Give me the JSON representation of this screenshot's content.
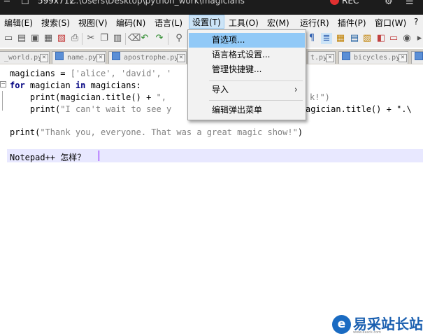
{
  "titlebar": {
    "title": "C:\\Users\\Desktop\\python_work\\magicians.py - Notepad++",
    "window_size": "599x712",
    "rec_label": "REC"
  },
  "menubar": {
    "items": [
      "编辑(E)",
      "搜索(S)",
      "视图(V)",
      "编码(N)",
      "语言(L)",
      "设置(T)",
      "工具(O)",
      "宏(M)",
      "运行(R)",
      "插件(P)",
      "窗口(W)",
      "?"
    ],
    "active": "设置(T)"
  },
  "tabs": [
    "_world.py",
    "name.py",
    "apostrophe.py",
    "t.py",
    "bicycles.py"
  ],
  "dropdown": {
    "items": [
      {
        "label": "首选项...",
        "selected": true
      },
      {
        "label": "语言格式设置..."
      },
      {
        "label": "管理快捷键..."
      },
      {
        "label": "导入",
        "submenu_arrow": "›"
      },
      {
        "label": "编辑弹出菜单"
      }
    ]
  },
  "editor": {
    "line1": {
      "code": "magicians = ",
      "str": "['alice', 'david', '"
    },
    "line2": {
      "kw": "for",
      "code": " magician ",
      "kw2": "in",
      "code2": " magicians:"
    },
    "line3": {
      "indent": "    ",
      "code": "print(magician.title() + ",
      "str": "\",",
      "str_tail": "k!\")"
    },
    "line4": {
      "indent": "    ",
      "code": "print(",
      "str": "\"I can't wait to see y",
      "tail": "agician.title() + \".\\"
    },
    "line5": {
      "code": "print(",
      "str": "\"Thank you, everyone. That was a great magic show!\"",
      "tail": ")"
    },
    "line6": {
      "code": "Notepad++ 怎样？"
    }
  },
  "watermark": {
    "logo_glyph": "e",
    "text": "易采站长站",
    "subtext": "www.easck.com"
  },
  "colors": {
    "menu_highlight": "#cce4f7",
    "dropdown_selected": "#91c9f7",
    "keyword": "#000080",
    "string": "#808080",
    "caret": "#8000ff",
    "current_line": "#e8e8ff"
  }
}
